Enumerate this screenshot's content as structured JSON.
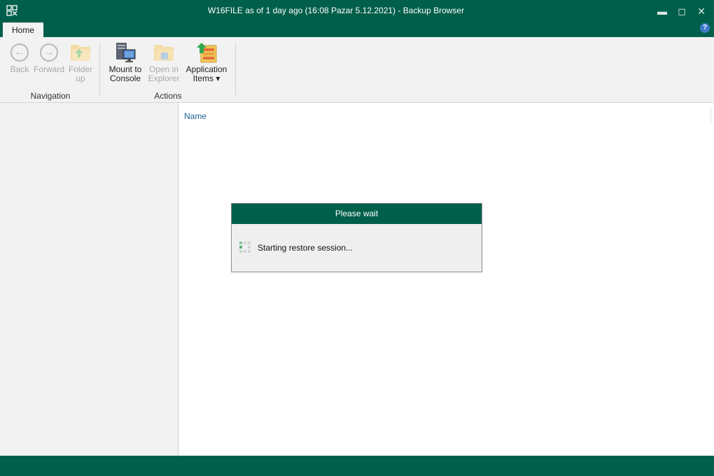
{
  "window": {
    "title": "W16FILE as of 1 day ago (16:08 Pazar 5.12.2021) - Backup Browser",
    "minimize": "▬",
    "maximize": "◻",
    "close": "✕",
    "help": "?"
  },
  "tabs": [
    {
      "label": "Home",
      "active": true
    }
  ],
  "ribbon": {
    "navigation": {
      "label": "Navigation",
      "back_label": "Back",
      "forward_label": "Forward",
      "folder_up_label_1": "Folder",
      "folder_up_label_2": "up"
    },
    "actions": {
      "label": "Actions",
      "mount_label_1": "Mount to",
      "mount_label_2": "Console",
      "open_explorer_label_1": "Open in",
      "open_explorer_label_2": "Explorer",
      "app_items_label_1": "Application",
      "app_items_label_2": "Items ▾"
    }
  },
  "file_list": {
    "columns": [
      "Name"
    ]
  },
  "dialog": {
    "title": "Please wait",
    "message": "Starting restore session..."
  },
  "colors": {
    "brand": "#005f4b",
    "ribbon_bg": "#f2f2f2",
    "header_text": "#1d5f8f"
  },
  "icons": {
    "app": "veeam-app-icon",
    "back": "back-arrow-icon",
    "forward": "forward-arrow-icon",
    "folder_up": "folder-up-icon",
    "mount": "server-console-icon",
    "open_explorer": "folder-explorer-icon",
    "app_items": "application-items-icon",
    "spinner": "progress-spinner-icon"
  }
}
